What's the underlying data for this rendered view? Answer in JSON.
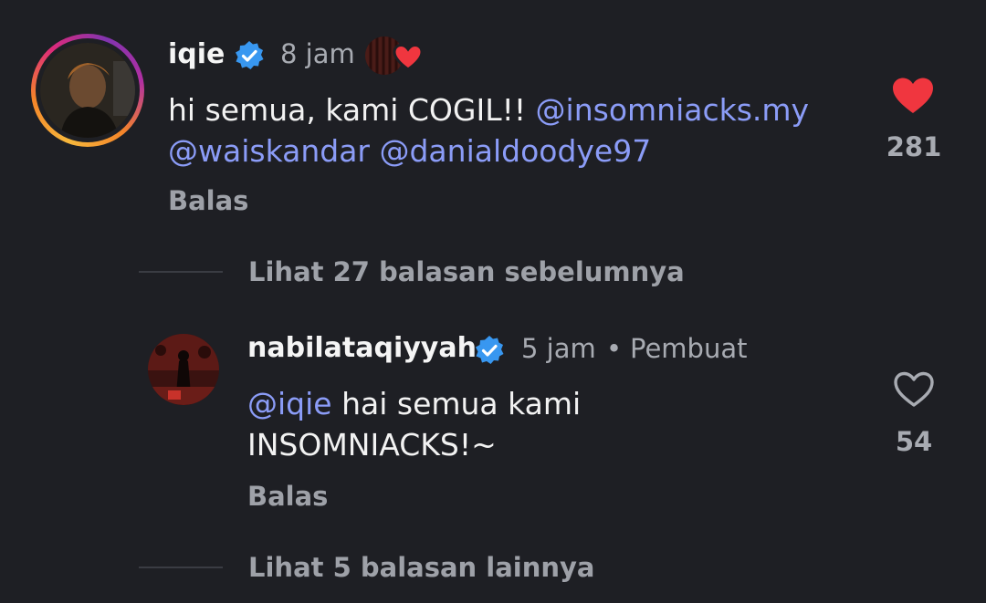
{
  "comments": [
    {
      "username": "iqie",
      "verified": true,
      "time": "8 jam",
      "text_prefix": "hi semua, kami COGIL!! ",
      "mentions_line1": [
        "@insomniacks.my"
      ],
      "mentions_line2": [
        "@waiskandar",
        "@danialdoodye97"
      ],
      "reply_label": "Balas",
      "likes": "281",
      "liked": true,
      "creator_liked": true,
      "avatar_icon": "user-avatar-photo"
    }
  ],
  "view_previous_replies": "Lihat 27 balasan sebelumnya",
  "reply": {
    "username": "nabilataqiyyah",
    "verified": true,
    "time": "5 jam",
    "separator": "•",
    "creator_label": "Pembuat",
    "mention": "@iqie",
    "text_line1": " hai semua kami",
    "text_line2": "INSOMNIACKS!~",
    "reply_label": "Balas",
    "likes": "54",
    "liked": false,
    "avatar_icon": "user-avatar-photo"
  },
  "view_more_replies": "Lihat 5 balasan lainnya",
  "colors": {
    "background": "#1e1f24",
    "mention": "#8b9cf7",
    "like_red": "#f0363f",
    "verified_blue": "#3897f0",
    "muted_text": "#9ea1a8"
  }
}
